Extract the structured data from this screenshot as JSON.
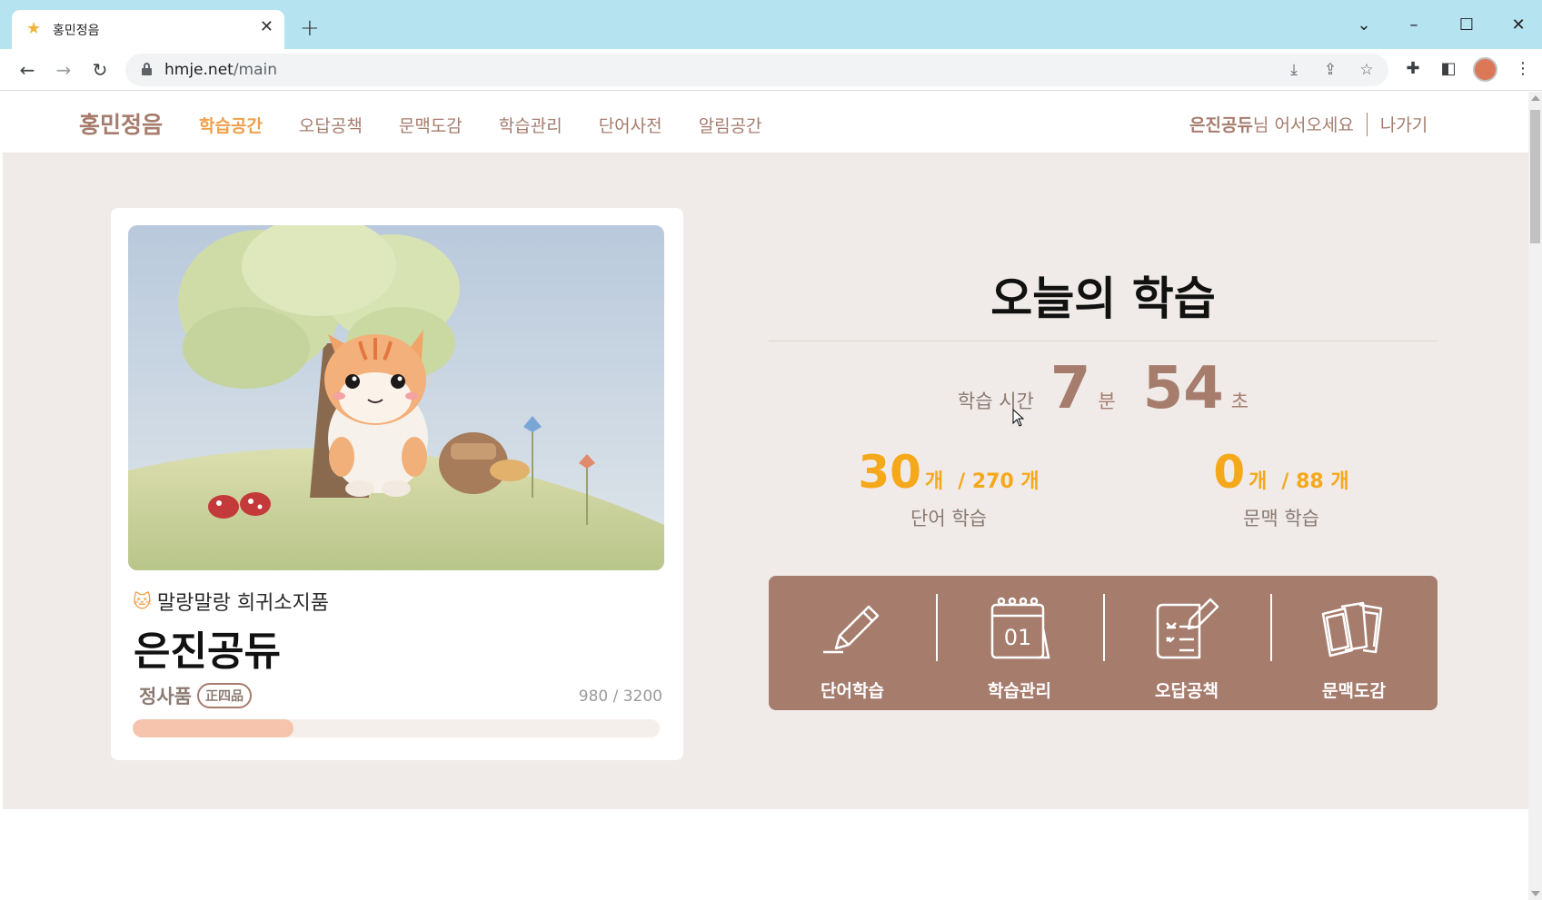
{
  "browser": {
    "tab_title": "홍민정음",
    "url_host": "hmje.net",
    "url_path": "/main",
    "icons": [
      "favicon-icon",
      "close-icon",
      "new-tab-icon",
      "minimize-icon",
      "maximize-icon",
      "close-window-icon",
      "back-icon",
      "forward-icon",
      "reload-icon",
      "lock-icon",
      "install-icon",
      "share-icon",
      "star-icon",
      "extensions-icon",
      "sidebar-icon",
      "menu-icon"
    ]
  },
  "site": {
    "logo": "홍민정음",
    "nav": [
      {
        "label": "학습공간",
        "active": true
      },
      {
        "label": "오답공책",
        "active": false
      },
      {
        "label": "문맥도감",
        "active": false
      },
      {
        "label": "학습관리",
        "active": false
      },
      {
        "label": "단어사전",
        "active": false
      },
      {
        "label": "알림공간",
        "active": false
      }
    ],
    "user": {
      "name": "은진공듀",
      "greeting": "님 어서오세요",
      "logout": "나가기"
    },
    "colors": {
      "brand": "#a67c6d",
      "active": "#f0a04b",
      "highlight": "#f5a81a",
      "background": "#f0ebe8",
      "progress": "#f6c4ad"
    }
  },
  "profile": {
    "stage": "말랑말랑 희귀소지품",
    "name": "은진공듀",
    "rank": "정사품",
    "rank_badge": "正四品",
    "exp_text": "980 / 3200",
    "exp_fraction": 0.306
  },
  "today": {
    "title": "오늘의 학습",
    "time_label": "학습 시간",
    "minutes": "7",
    "minutes_unit": "분",
    "seconds": "54",
    "seconds_unit": "초",
    "word": {
      "count": "30",
      "unit": "개",
      "total": "/ 270 개",
      "label": "단어 학습"
    },
    "context": {
      "count": "0",
      "unit": "개",
      "total": "/ 88 개",
      "label": "문맥 학습"
    }
  },
  "menu": [
    {
      "label": "단어학습",
      "icon": "pencil-icon"
    },
    {
      "label": "학습관리",
      "icon": "calendar-icon"
    },
    {
      "label": "오답공책",
      "icon": "checklist-icon"
    },
    {
      "label": "문맥도감",
      "icon": "cards-icon"
    }
  ],
  "calendar_icon_text": "01"
}
